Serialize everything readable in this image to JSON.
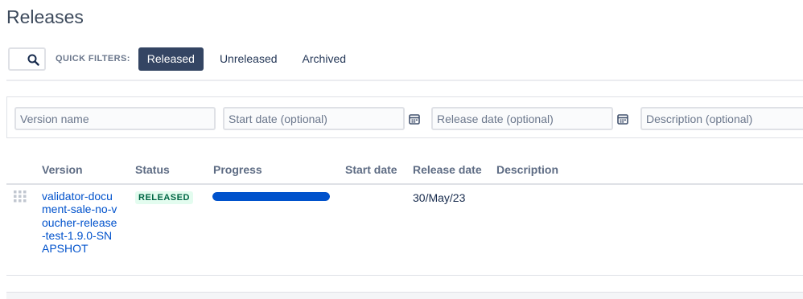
{
  "page": {
    "title": "Releases"
  },
  "filters": {
    "search_placeholder": "",
    "label": "QUICK FILTERS:",
    "buttons": [
      {
        "label": "Released",
        "active": true
      },
      {
        "label": "Unreleased",
        "active": false
      },
      {
        "label": "Archived",
        "active": false
      }
    ]
  },
  "form": {
    "version_placeholder": "Version name",
    "start_placeholder": "Start date (optional)",
    "release_placeholder": "Release date (optional)",
    "description_placeholder": "Description (optional)"
  },
  "table": {
    "columns": [
      "Version",
      "Status",
      "Progress",
      "Start date",
      "Release date",
      "Description"
    ],
    "rows": [
      {
        "version": "validator-document-sale-no-voucher-release-test-1.9.0-SNAPSHOT",
        "status": "RELEASED",
        "progress": 1.0,
        "start_date": "",
        "release_date": "30/May/23",
        "description": ""
      }
    ]
  },
  "colors": {
    "accent": "#0052cc",
    "active_filter": "#344563",
    "status_bg": "#e3fcef",
    "status_text": "#006644"
  }
}
